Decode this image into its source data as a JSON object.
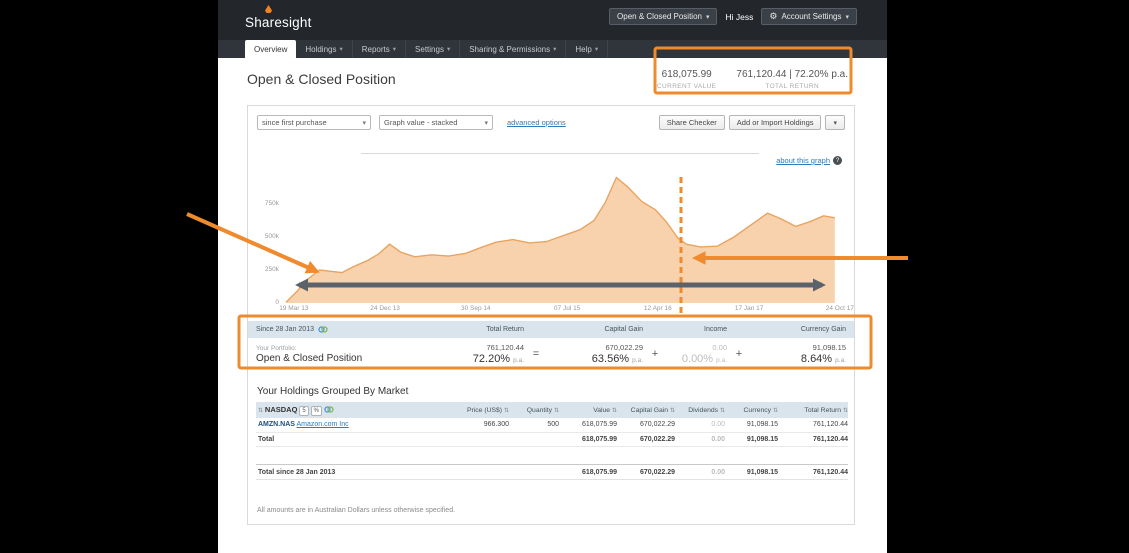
{
  "icons": {
    "caret_down": "▾",
    "gear": "⚙",
    "question": "?",
    "sort": "⇅"
  },
  "header": {
    "logo_text": "Sharesight",
    "portfolio_button": "Open & Closed Position",
    "greeting": "Hi Jess",
    "account_settings_button": "Account Settings"
  },
  "nav": {
    "tabs": [
      {
        "label": "Overview"
      },
      {
        "label": "Holdings"
      },
      {
        "label": "Reports"
      },
      {
        "label": "Settings"
      },
      {
        "label": "Sharing & Permissions"
      },
      {
        "label": "Help"
      }
    ]
  },
  "page_header": {
    "title": "Open & Closed Position",
    "current_value": "618,075.99",
    "current_value_label": "CURRENT VALUE",
    "total_return": "761,120.44 | 72.20% p.a.",
    "total_return_label": "TOTAL RETURN"
  },
  "toolbar": {
    "period_select_value": "since first purchase",
    "graph_select_value": "Graph value - stacked",
    "advanced_options_link": "advanced options",
    "share_checker_button": "Share Checker",
    "add_import_button": "Add or Import Holdings"
  },
  "chart": {
    "about_link": "about this graph"
  },
  "chart_data": {
    "type": "area",
    "title": "Portfolio value over time",
    "xlabel": "",
    "ylabel": "",
    "grid": false,
    "legend": false,
    "values_unit": "AUD thousands",
    "ylim_k": [
      0,
      1113
    ],
    "y_ticks_k": [
      {
        "v": 0,
        "label": "0"
      },
      {
        "v": 250,
        "label": "250k"
      },
      {
        "v": 500,
        "label": "500k"
      },
      {
        "v": 750,
        "label": "750k"
      }
    ],
    "x_ticks": [
      {
        "f": 0.014,
        "label": "19 Mar 13"
      },
      {
        "f": 0.177,
        "label": "24 Dec 13"
      },
      {
        "f": 0.339,
        "label": "30 Sep 14"
      },
      {
        "f": 0.502,
        "label": "07 Jul 15"
      },
      {
        "f": 0.664,
        "label": "12 Apr 16"
      },
      {
        "f": 0.827,
        "label": "17 Jan 17"
      },
      {
        "f": 0.989,
        "label": "24 Oct 17"
      }
    ],
    "series": [
      {
        "name": "Graph value - stacked",
        "points_k": [
          [
            0.0,
            5
          ],
          [
            0.02,
            90
          ],
          [
            0.04,
            185
          ],
          [
            0.06,
            250
          ],
          [
            0.08,
            240
          ],
          [
            0.1,
            230
          ],
          [
            0.12,
            275
          ],
          [
            0.145,
            320
          ],
          [
            0.165,
            370
          ],
          [
            0.185,
            445
          ],
          [
            0.205,
            385
          ],
          [
            0.23,
            350
          ],
          [
            0.26,
            365
          ],
          [
            0.29,
            355
          ],
          [
            0.32,
            375
          ],
          [
            0.345,
            415
          ],
          [
            0.375,
            460
          ],
          [
            0.405,
            480
          ],
          [
            0.435,
            455
          ],
          [
            0.465,
            465
          ],
          [
            0.495,
            510
          ],
          [
            0.525,
            555
          ],
          [
            0.55,
            625
          ],
          [
            0.57,
            760
          ],
          [
            0.59,
            950
          ],
          [
            0.61,
            880
          ],
          [
            0.635,
            770
          ],
          [
            0.66,
            705
          ],
          [
            0.68,
            610
          ],
          [
            0.7,
            490
          ],
          [
            0.715,
            445
          ],
          [
            0.74,
            425
          ],
          [
            0.77,
            430
          ],
          [
            0.8,
            500
          ],
          [
            0.83,
            590
          ],
          [
            0.86,
            680
          ],
          [
            0.885,
            635
          ],
          [
            0.91,
            580
          ],
          [
            0.935,
            615
          ],
          [
            0.96,
            660
          ],
          [
            0.98,
            645
          ]
        ]
      }
    ],
    "annotations": {
      "dashed_line_x_frac": 0.707,
      "highlight_boxes": [
        "header-current-value-and-total-return",
        "portfolio-summary-row"
      ],
      "arrows": [
        "orange-arrow-into-chart",
        "orange-arrow-to-dashed-line",
        "gray-date-range-double-arrow"
      ]
    }
  },
  "summary": {
    "since_label": "Since 28 Jan 2013",
    "col_total_return": "Total Return",
    "col_capital_gain": "Capital Gain",
    "col_income": "Income",
    "col_currency_gain": "Currency Gain",
    "portfolio_prefix": "Your Portfolio:",
    "portfolio_name": "Open & Closed Position",
    "op_equals": "=",
    "op_plus": "+",
    "total_return_value": "761,120.44",
    "total_return_pct": "72.20%",
    "capital_gain_value": "670,022.29",
    "capital_gain_pct": "63.56%",
    "income_value": "0.00",
    "income_pct": "0.00%",
    "currency_gain_value": "91,098.15",
    "currency_gain_pct": "8.64%",
    "pa_suffix": "p.a."
  },
  "holdings": {
    "section_title": "Your Holdings Grouped By Market",
    "market_name": "NASDAQ",
    "market_count_badge": "5",
    "market_percent_badge": "%",
    "col_price": "Price (US$)",
    "col_quantity": "Quantity",
    "col_value": "Value",
    "col_capital_gain": "Capital Gain",
    "col_dividends": "Dividends",
    "col_currency": "Currency",
    "col_total_return": "Total Return",
    "rows": [
      {
        "code": "AMZN.NAS",
        "name": "Amazon.com Inc",
        "price": "966.300",
        "quantity": "500",
        "value": "618,075.99",
        "capital_gain": "670,022.29",
        "dividends": "0.00",
        "currency": "91,098.15",
        "total_return": "761,120.44"
      }
    ],
    "total_row": {
      "label": "Total",
      "value": "618,075.99",
      "capital_gain": "670,022.29",
      "dividends": "0.00",
      "currency": "91,098.15",
      "total_return": "761,120.44"
    },
    "grand_total_row": {
      "label": "Total since 28 Jan 2013",
      "value": "618,075.99",
      "capital_gain": "670,022.29",
      "dividends": "0.00",
      "currency": "91,098.15",
      "total_return": "761,120.44"
    },
    "footnote": "All amounts are in Australian Dollars unless otherwise specified."
  }
}
